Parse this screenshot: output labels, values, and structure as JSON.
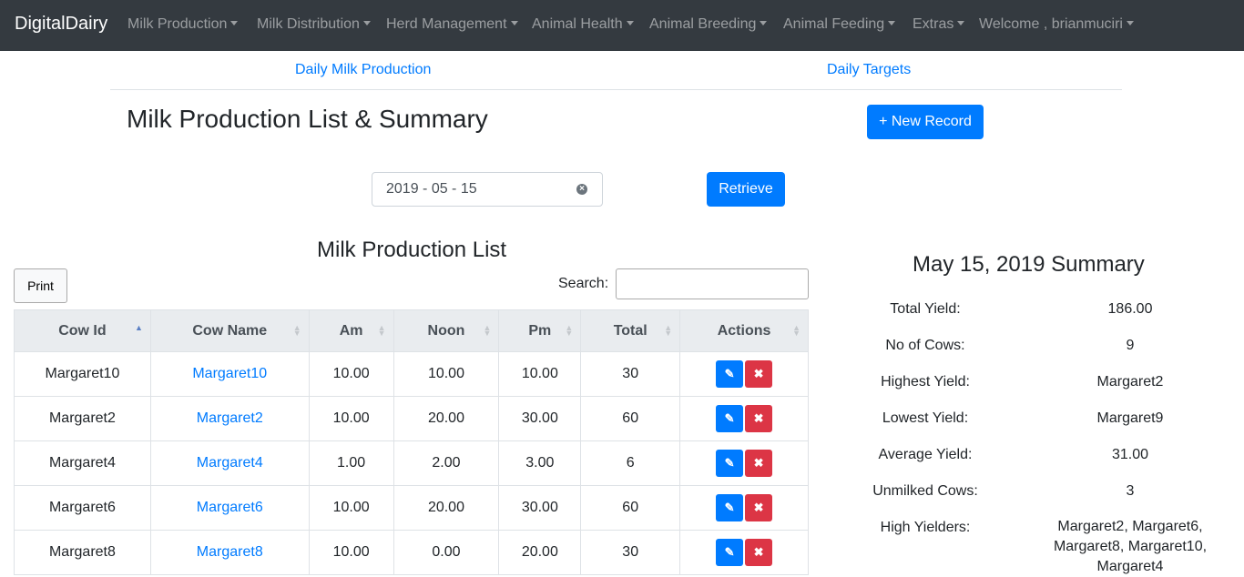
{
  "navbar": {
    "brand": "DigitalDairy",
    "items": [
      {
        "label": "Milk Production"
      },
      {
        "label": "Milk Distribution"
      },
      {
        "label": "Herd Management"
      },
      {
        "label": "Animal Health"
      },
      {
        "label": "Animal Breeding"
      },
      {
        "label": "Animal Feeding"
      },
      {
        "label": "Extras"
      },
      {
        "label": "Welcome , brianmuciri"
      }
    ]
  },
  "subnav": {
    "left_link": "Daily Milk Production",
    "right_link": "Daily Targets"
  },
  "page": {
    "title": "Milk Production List & Summary",
    "new_record_label": "+ New Record",
    "date_value": "2019 - 05 - 15",
    "retrieve_label": "Retrieve"
  },
  "list": {
    "title": "Milk Production List",
    "print_label": "Print",
    "search_label": "Search:",
    "columns": [
      "Cow Id",
      "Cow Name",
      "Am",
      "Noon",
      "Pm",
      "Total",
      "Actions"
    ],
    "rows": [
      {
        "cow_id": "Margaret10",
        "cow_name": "Margaret10",
        "am": "10.00",
        "noon": "10.00",
        "pm": "10.00",
        "total": "30"
      },
      {
        "cow_id": "Margaret2",
        "cow_name": "Margaret2",
        "am": "10.00",
        "noon": "20.00",
        "pm": "30.00",
        "total": "60"
      },
      {
        "cow_id": "Margaret4",
        "cow_name": "Margaret4",
        "am": "1.00",
        "noon": "2.00",
        "pm": "3.00",
        "total": "6"
      },
      {
        "cow_id": "Margaret6",
        "cow_name": "Margaret6",
        "am": "10.00",
        "noon": "20.00",
        "pm": "30.00",
        "total": "60"
      },
      {
        "cow_id": "Margaret8",
        "cow_name": "Margaret8",
        "am": "10.00",
        "noon": "0.00",
        "pm": "20.00",
        "total": "30"
      }
    ]
  },
  "summary": {
    "title": "May 15, 2019 Summary",
    "items": [
      {
        "label": "Total Yield:",
        "value": "186.00"
      },
      {
        "label": "No of Cows:",
        "value": "9"
      },
      {
        "label": "Highest Yield:",
        "value": "Margaret2"
      },
      {
        "label": "Lowest Yield:",
        "value": "Margaret9"
      },
      {
        "label": "Average Yield:",
        "value": "31.00"
      },
      {
        "label": "Unmilked Cows:",
        "value": "3"
      },
      {
        "label": "High Yielders:",
        "value": "Margaret2, Margaret6, Margaret8, Margaret10, Margaret4"
      }
    ]
  },
  "colors": {
    "navbar": "#343a40",
    "primary": "#007bff",
    "danger": "#dc3545"
  }
}
